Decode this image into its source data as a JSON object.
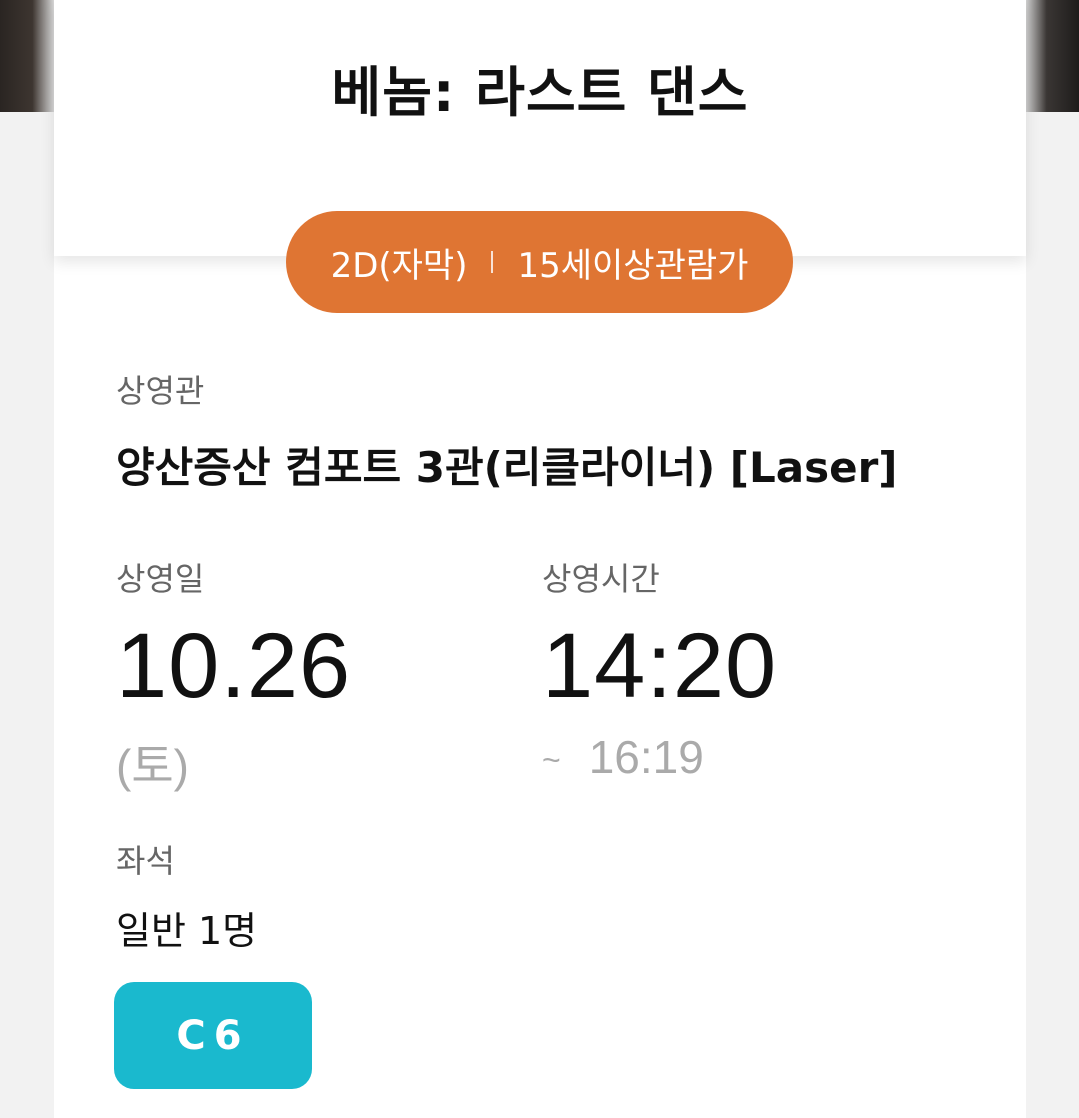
{
  "movie": {
    "title": "베놈: 라스트 댄스",
    "format": "2D(자막)",
    "rating": "15세이상관람가"
  },
  "theater": {
    "label": "상영관",
    "name": "양산증산 컴포트 3관(리클라이너) [Laser]"
  },
  "schedule": {
    "date_label": "상영일",
    "date": "10.26",
    "weekday": "(토)",
    "time_label": "상영시간",
    "start_time": "14:20",
    "end_prefix": "~",
    "end_time": "16:19"
  },
  "seat": {
    "label": "좌석",
    "count": "일반 1명",
    "number": "C6"
  },
  "colors": {
    "pill": "#df7533",
    "seat_badge": "#1ab9ce"
  }
}
